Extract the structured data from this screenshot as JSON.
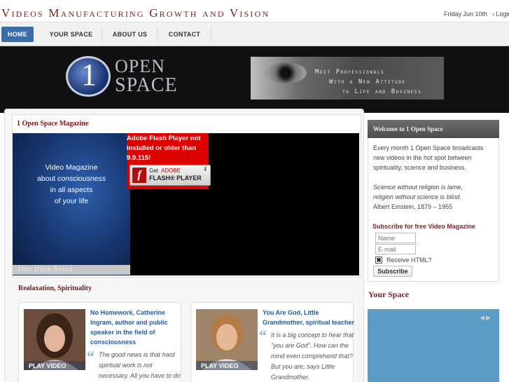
{
  "header": {
    "site_title": "Videos Manufacturing Growth and Vision",
    "date": "Friday Jun 10th",
    "login": "› Login"
  },
  "nav": {
    "items": [
      {
        "label": "HOME",
        "active": true
      },
      {
        "label": "YOUR SPACE",
        "active": false
      },
      {
        "label": "ABOUT US",
        "active": false
      },
      {
        "label": "CONTACT",
        "active": false
      }
    ]
  },
  "banner": {
    "logo_one": "1",
    "logo_open": "OPEN",
    "logo_space": "SPACE",
    "taglines": [
      "Meet Professionals",
      "With a New Attitude",
      "to Life and Business"
    ]
  },
  "magazine": {
    "heading": "1 Open Space Magazine",
    "panel_lines": [
      "Video Magazine",
      "about ",
      "consciousness",
      "in all aspects",
      "of your life"
    ],
    "panel_footer": "One Open Space",
    "flash": {
      "lines": [
        "Adobe Flash Player not",
        "installed or older than",
        "9.0.115!"
      ],
      "get": "Get",
      "adobe": "ADOBE",
      "player": "FLASH® PLAYER"
    }
  },
  "spirituality": {
    "heading": "Realaxation, Spirituality",
    "cards": [
      {
        "play": "PLAY VIDEO",
        "title_lines": [
          "No Homework, Catherine",
          "Ingram, author and public",
          "speaker in the field of",
          "consciousness"
        ],
        "quote_lines": [
          "The good news is that hard",
          "spiritual work is not",
          "necessary. All you have to do"
        ]
      },
      {
        "play": "PLAY VIDEO",
        "title_lines": [
          "You Are God, Little",
          "Grandmother, spiritual teacher"
        ],
        "quote_lines": [
          "It is a big concept to hear that",
          "\"you are God\". How can the",
          "mind even comprehend that?",
          "But you are, says Little",
          "Grandmother."
        ]
      }
    ]
  },
  "sidebar": {
    "welcome_title": "Welcome to 1 Open Space",
    "intro_lines": [
      "Every month 1 Open Space broadcasts",
      "new videos in the hot spot between",
      "spirituality, science and business."
    ],
    "quote_lines": [
      "Science without religion is lame,",
      "religion without science is blind."
    ],
    "quote_author": "Albert Einstein, 1879 – 1955",
    "subscribe_heading": "Subscribe for free Video Magazine",
    "name_placeholder": "Name",
    "email_placeholder": "E-mail",
    "checkbox_label": "Receive HTML?",
    "subscribe_button": "Subscribe",
    "your_space_heading": "Your Space"
  },
  "colors": {
    "brand_red": "#8a1e23",
    "nav_active": "#3a6da5",
    "link_blue": "#2b5a99",
    "your_space_panel": "#5b9cc4"
  },
  "icons": {
    "login": "chevron-right-icon",
    "quote": "quote-icon",
    "slider_prev": "arrow-left-icon",
    "slider_next": "arrow-right-icon"
  }
}
